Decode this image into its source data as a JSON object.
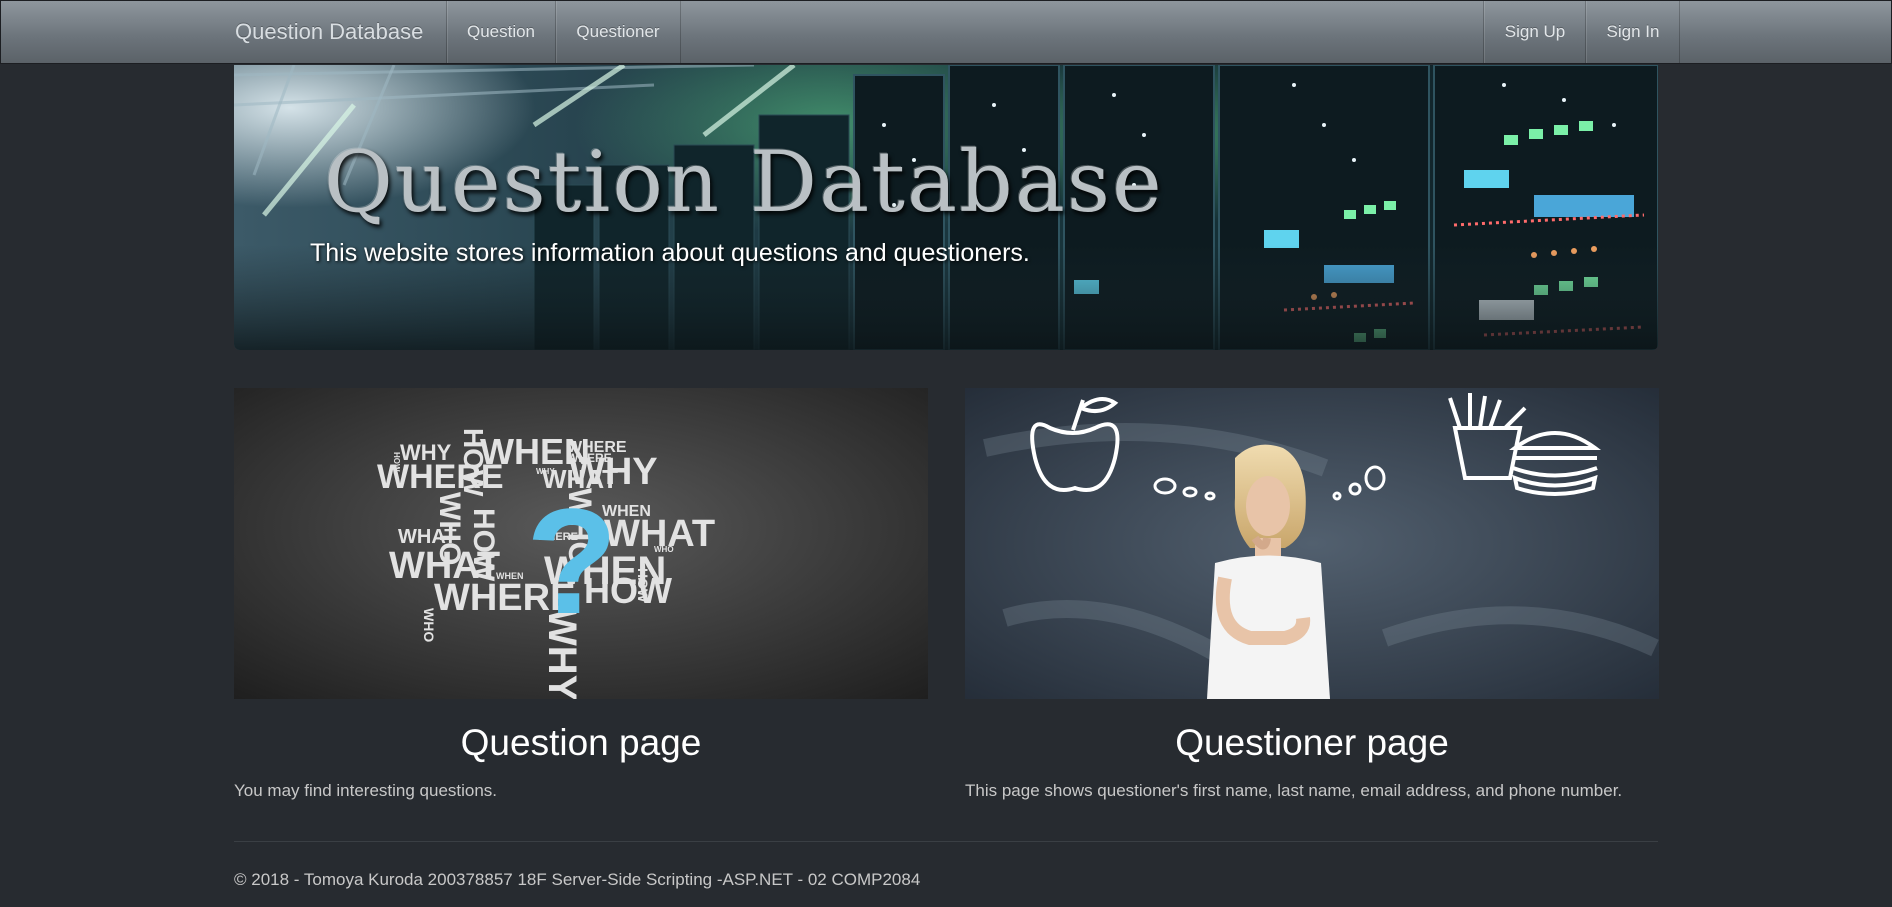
{
  "navbar": {
    "brand": "Question Database",
    "left_items": [
      {
        "label": "Question"
      },
      {
        "label": "Questioner"
      }
    ],
    "right_items": [
      {
        "label": "Sign Up"
      },
      {
        "label": "Sign In"
      }
    ]
  },
  "hero": {
    "title": "Question Database",
    "subtitle": "This website stores information about questions and questioners."
  },
  "cards": [
    {
      "image_icon": "question-word-cloud-image",
      "title": "Question page",
      "text": "You may find interesting questions.",
      "cloud_words": [
        "WHY",
        "HOW",
        "WHEN",
        "WHERE",
        "WHY",
        "WHERE",
        "WHO",
        "WHAT",
        "WHAT",
        "WHO",
        "WHEN",
        "WHAT",
        "WHEN",
        "HOW",
        "WHERE",
        "WHY",
        "HOW",
        "WHO",
        "HOW",
        "WHERE",
        "WHY",
        "WHEN",
        "WHERE",
        "WHO",
        "HOW",
        "WHAT"
      ]
    },
    {
      "image_icon": "thinking-woman-image",
      "title": "Questioner page",
      "text": "This page shows questioner's first name, last name, email address, and phone number."
    }
  ],
  "footer": {
    "text": "© 2018 - Tomoya Kuroda 200378857 18F Server-Side Scripting -ASP.NET - 02 COMP2084"
  },
  "colors": {
    "page_background": "#272b30",
    "navbar_gradient_top": "#8e969d",
    "navbar_gradient_bottom": "#5b6268",
    "question_mark": "#5bc0e8"
  }
}
